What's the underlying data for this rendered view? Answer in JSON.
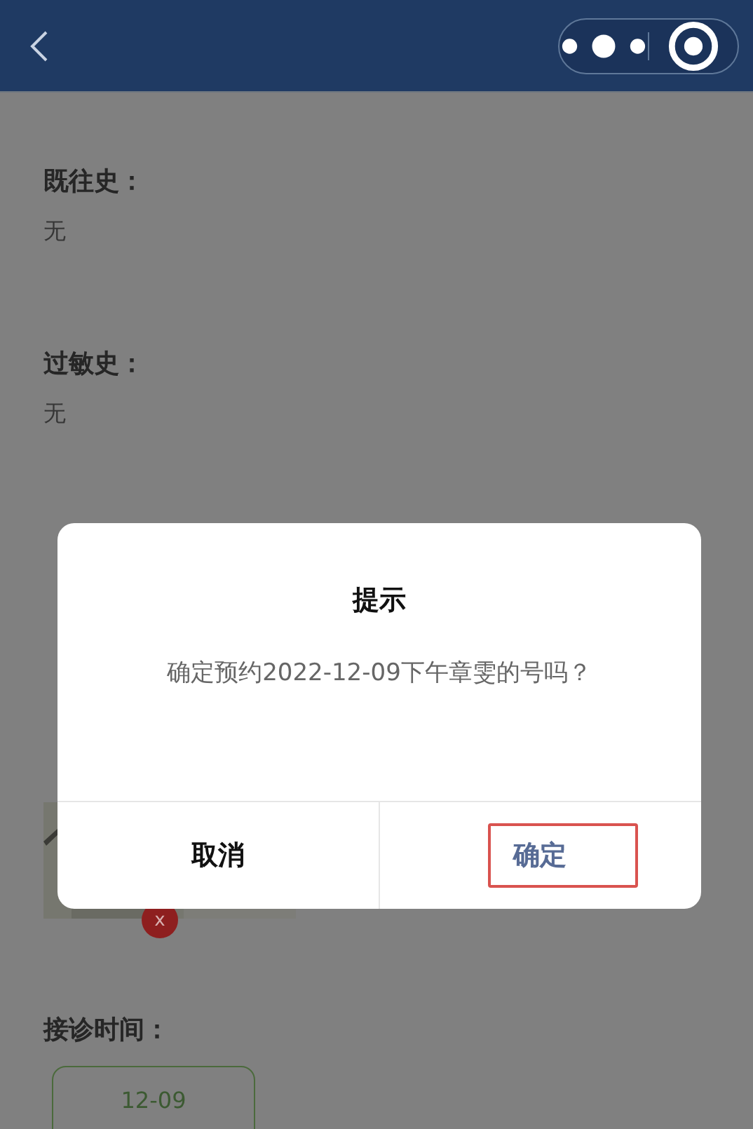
{
  "sections": [
    {
      "label": "既往史：",
      "value": "无"
    },
    {
      "label": "过敏史：",
      "value": "无"
    }
  ],
  "photo": {
    "kind": "picture",
    "delete_badge": "x"
  },
  "visit_time": {
    "label": "接诊时间：",
    "dates": [
      "12-09"
    ]
  },
  "dialog": {
    "title": "提示",
    "message": "确定预约2022-12-09下午章雯的号吗？",
    "buttons": [
      {
        "label": "取消",
        "kind": "cancel"
      },
      {
        "label": "确定",
        "kind": "confirm"
      }
    ]
  }
}
